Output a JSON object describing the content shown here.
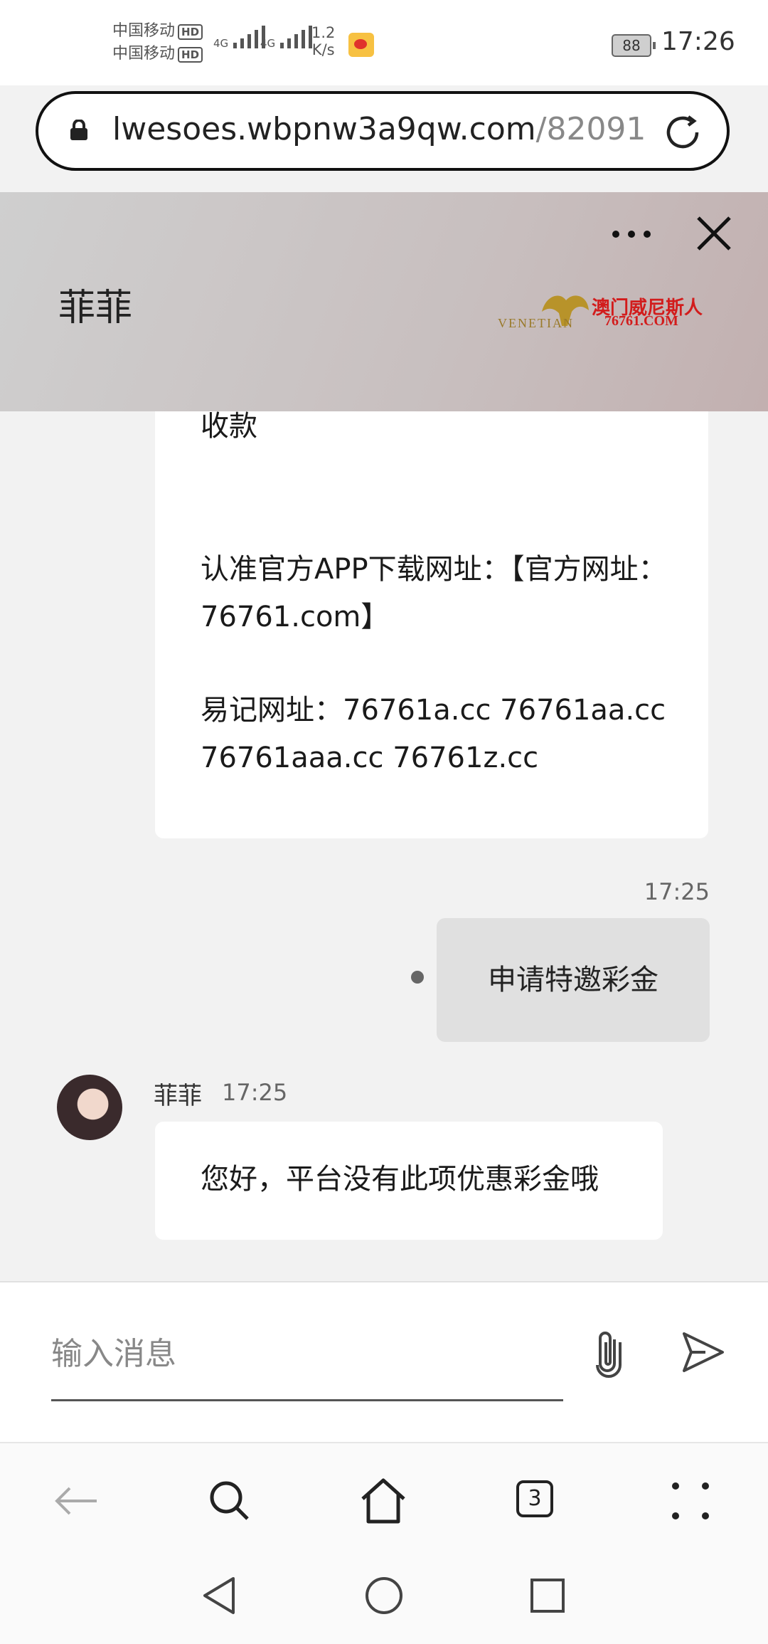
{
  "status_bar": {
    "carrier1": "中国移动",
    "carrier2": "中国移动",
    "hd": "HD",
    "net1": "4G",
    "net2": "4G",
    "speed_value": "1.2",
    "speed_unit": "K/s",
    "battery": "88",
    "time": "17:26"
  },
  "url_bar": {
    "host": "lwesoes.wbpnw3a9qw.com",
    "path": "/82091"
  },
  "chat": {
    "title": "菲菲",
    "logo_text": "澳门威尼斯人",
    "logo_sub": "76761.COM",
    "logo_left": "VENETIAN"
  },
  "messages": {
    "incoming1": {
      "line_receive": "收款",
      "line_app": "认准官方APP下载网址：【官方网址：76761.com】",
      "line_easy": "易记网址：76761a.cc 76761aa.cc 76761aaa.cc 76761z.cc"
    },
    "outgoing": {
      "time": "17:25",
      "text": "申请特邀彩金"
    },
    "incoming2": {
      "sender": "菲菲",
      "time": "17:25",
      "text": "您好，平台没有此项优惠彩金哦"
    }
  },
  "input": {
    "placeholder": "输入消息"
  },
  "browser_nav": {
    "tab_count": "3"
  }
}
